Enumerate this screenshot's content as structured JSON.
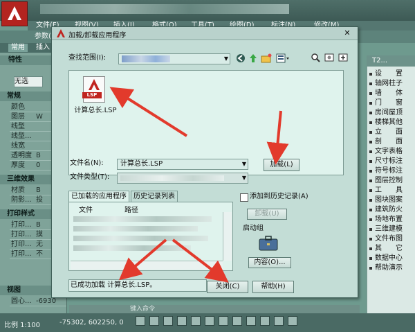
{
  "app": {
    "menu": [
      "文件(F)",
      "视图(V)",
      "插入(I)",
      "格式(O)",
      "工具(T)",
      "绘图(D)",
      "标注(N)",
      "修改(M)"
    ],
    "ribbon_label": "参数(P)",
    "tabs": [
      "常用",
      "插入"
    ],
    "palette": {
      "title": "特性",
      "combo_value": "无选",
      "sections": [
        {
          "title": "常规",
          "rows": [
            {
              "label": "颜色",
              "value": ""
            },
            {
              "label": "图层",
              "value": "W"
            },
            {
              "label": "线型",
              "value": ""
            },
            {
              "label": "线型...",
              "value": ""
            },
            {
              "label": "线宽",
              "value": ""
            },
            {
              "label": "透明度",
              "value": "B"
            },
            {
              "label": "厚度",
              "value": "0"
            }
          ]
        },
        {
          "title": "三维效果",
          "rows": [
            {
              "label": "材质",
              "value": "B"
            },
            {
              "label": "阴影...",
              "value": "投"
            }
          ]
        },
        {
          "title": "打印样式",
          "rows": [
            {
              "label": "打印...",
              "value": "B"
            },
            {
              "label": "打印...",
              "value": "摸"
            },
            {
              "label": "打印...",
              "value": "无"
            },
            {
              "label": "打印...",
              "value": "不"
            }
          ]
        },
        {
          "title": "视图",
          "rows": [
            {
              "label": "圆心...",
              "value": "-6930"
            }
          ]
        }
      ]
    },
    "right_panel": {
      "title": "T2...",
      "items": [
        "设　　置",
        "轴网柱子",
        "墙　　体",
        "门　　窗",
        "房间屋顶",
        "楼梯其他",
        "立　　面",
        "剖　　面",
        "文字表格",
        "尺寸标注",
        "符号标注",
        "图层控制",
        "工　　具",
        "图块图案",
        "建筑防火",
        "场地布置",
        "三维建模",
        "文件布图",
        "其　　它",
        "数据中心",
        "帮助演示"
      ]
    },
    "command_hint": "键入命令",
    "status": {
      "scale": "比例 1:100",
      "coords": "-75302, 602250, 0"
    }
  },
  "dialog": {
    "title": "加载/卸载应用程序",
    "close_glyph": "✕",
    "look_in_label": "查找范围(I):",
    "file": {
      "name": "计算总长.LSP",
      "badge": "LSP"
    },
    "file_name_label": "文件名(N):",
    "file_name_value": "计算总长.LSP",
    "file_type_label": "文件类型(T):",
    "load_button": "加载(L)",
    "tabs": [
      "已加载的应用程序",
      "历史记录列表"
    ],
    "list_columns": [
      "文件",
      "路径"
    ],
    "add_history_label": "添加到历史记录(A)",
    "unload_button": "卸载(U)",
    "startup_group_label": "启动组",
    "contents_button": "内容(O)...",
    "status_message": "已成功加载 计算总长.LSP。",
    "close_button": "关闭(C)",
    "help_button": "帮助(H)"
  },
  "colors": {
    "accent_red": "#c0241f",
    "arrow_red": "#e23a2c",
    "dialog_bg": "#c3ddd6",
    "list_bg": "#dff3ed"
  }
}
